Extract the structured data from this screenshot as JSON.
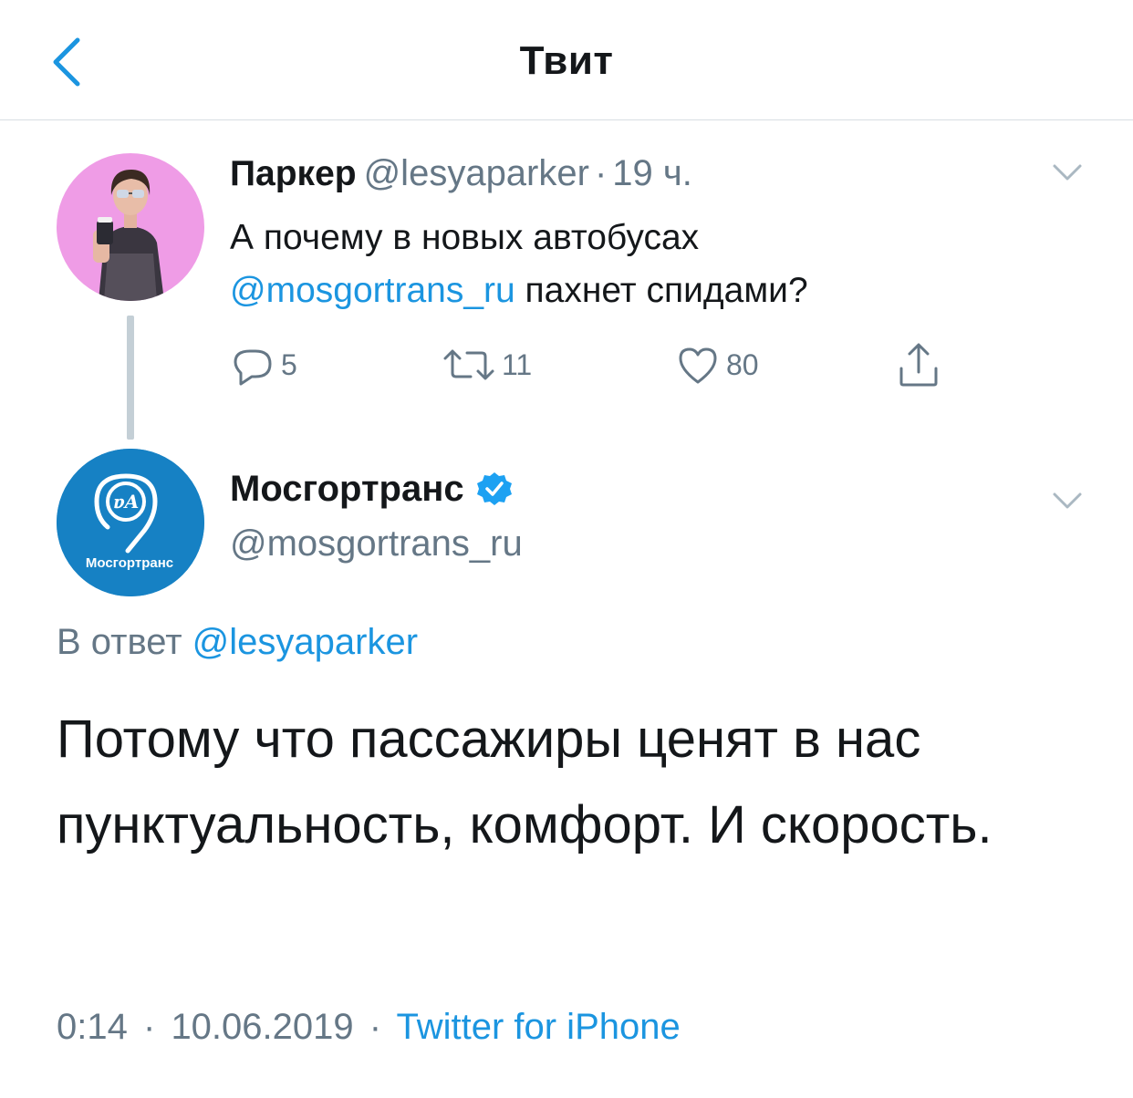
{
  "header": {
    "title": "Твит"
  },
  "parent_tweet": {
    "name": "Паркер",
    "handle": "@lesyaparker",
    "separator": "·",
    "time": "19 ч.",
    "text_before": "А почему в новых автобусах",
    "mention": "@mosgortrans_ru",
    "text_after": " пахнет спидами?",
    "actions": {
      "reply_count": "5",
      "retweet_count": "11",
      "like_count": "80"
    }
  },
  "main_tweet": {
    "name": "Мосгортранс",
    "handle": "@mosgortrans_ru",
    "avatar_label": "Мосгортранс",
    "reply_label": "В ответ",
    "reply_mention": "@lesyaparker",
    "text": "Потому что пассажиры ценят в нас пунктуальность, комфорт. И скорость.",
    "time": "0:14",
    "date": "10.06.2019",
    "separator": "·",
    "source": "Twitter for iPhone"
  },
  "colors": {
    "accent": "#1b95e0",
    "muted": "#657786",
    "text": "#14171a",
    "mosgortrans_blue": "#1681c4",
    "divider": "#d8dee3"
  },
  "icons": {
    "back": "chevron-left-icon",
    "caret": "chevron-down-icon",
    "reply": "reply-icon",
    "retweet": "retweet-icon",
    "like": "heart-icon",
    "share": "share-icon",
    "verified": "verified-badge-icon"
  }
}
